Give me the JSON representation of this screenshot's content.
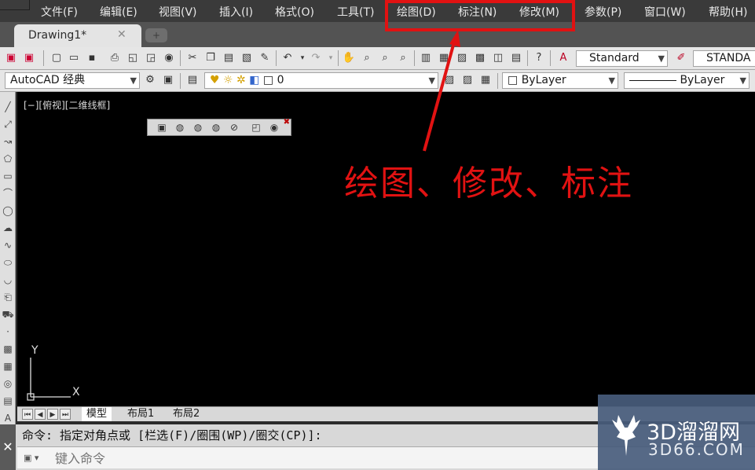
{
  "menubar": {
    "items": [
      {
        "label": "文件(F)"
      },
      {
        "label": "编辑(E)"
      },
      {
        "label": "视图(V)"
      },
      {
        "label": "插入(I)"
      },
      {
        "label": "格式(O)"
      },
      {
        "label": "工具(T)"
      },
      {
        "label": "绘图(D)"
      },
      {
        "label": "标注(N)"
      },
      {
        "label": "修改(M)"
      },
      {
        "label": "参数(P)"
      },
      {
        "label": "窗口(W)"
      },
      {
        "label": "帮助(H)"
      }
    ]
  },
  "tabs": {
    "active_label": "Drawing1*",
    "close_glyph": "✕",
    "new_tab_glyph": "+"
  },
  "toolbar": {
    "text_style_value": "Standard",
    "dim_style_value": "STANDA",
    "workspace_value": "AutoCAD 经典",
    "layer_value": "0",
    "color_value": "ByLayer",
    "linetype_value": "ByLayer"
  },
  "canvas": {
    "viewport_label": "[−][俯视][二维线框]",
    "annotation_text": "绘图、修改、标注",
    "ucs_y_label": "Y",
    "ucs_x_label": "X",
    "annotation_color": "#e11212",
    "background_color": "#000000"
  },
  "layout_tabs": [
    {
      "label": "模型"
    },
    {
      "label": "布局1"
    },
    {
      "label": "布局2"
    }
  ],
  "command": {
    "history_text": "命令: 指定对角点或 [栏选(F)/圈围(WP)/圈交(CP)]:",
    "input_placeholder": "键入命令",
    "close_glyph": "✕"
  },
  "watermark": {
    "brand": "3D溜溜网",
    "url": "3D66.COM"
  }
}
